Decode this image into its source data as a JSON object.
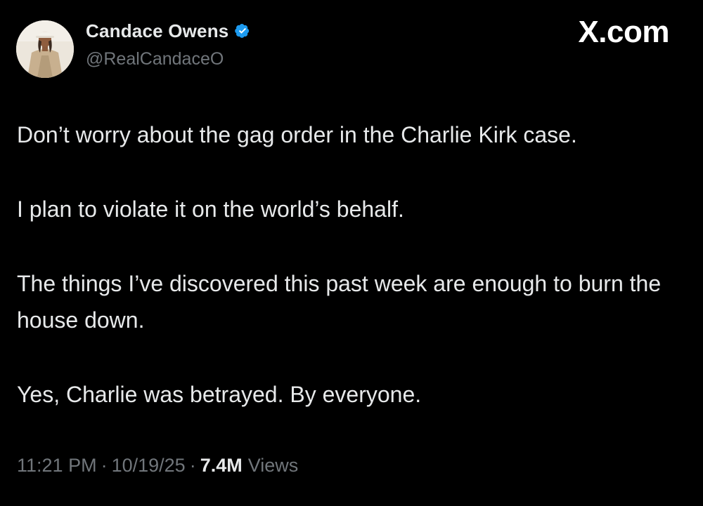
{
  "brand": "X.com",
  "author": {
    "display_name": "Candace Owens",
    "handle": "@RealCandaceO",
    "verified": true,
    "verified_color": "#1d9bf0"
  },
  "tweet": {
    "paragraphs": [
      "Don’t worry about the gag order in the Charlie Kirk case.",
      "I plan to violate it on the world’s behalf.",
      "The things I’ve discovered this past week are enough to burn the house down.",
      "Yes, Charlie was betrayed. By everyone."
    ]
  },
  "meta": {
    "time": "11:21 PM",
    "date": "10/19/25",
    "views_count": "7.4M",
    "views_label": "Views",
    "separator": "·"
  },
  "colors": {
    "background": "#000000",
    "primary_text": "#e7e9ea",
    "secondary_text": "#71767b"
  }
}
